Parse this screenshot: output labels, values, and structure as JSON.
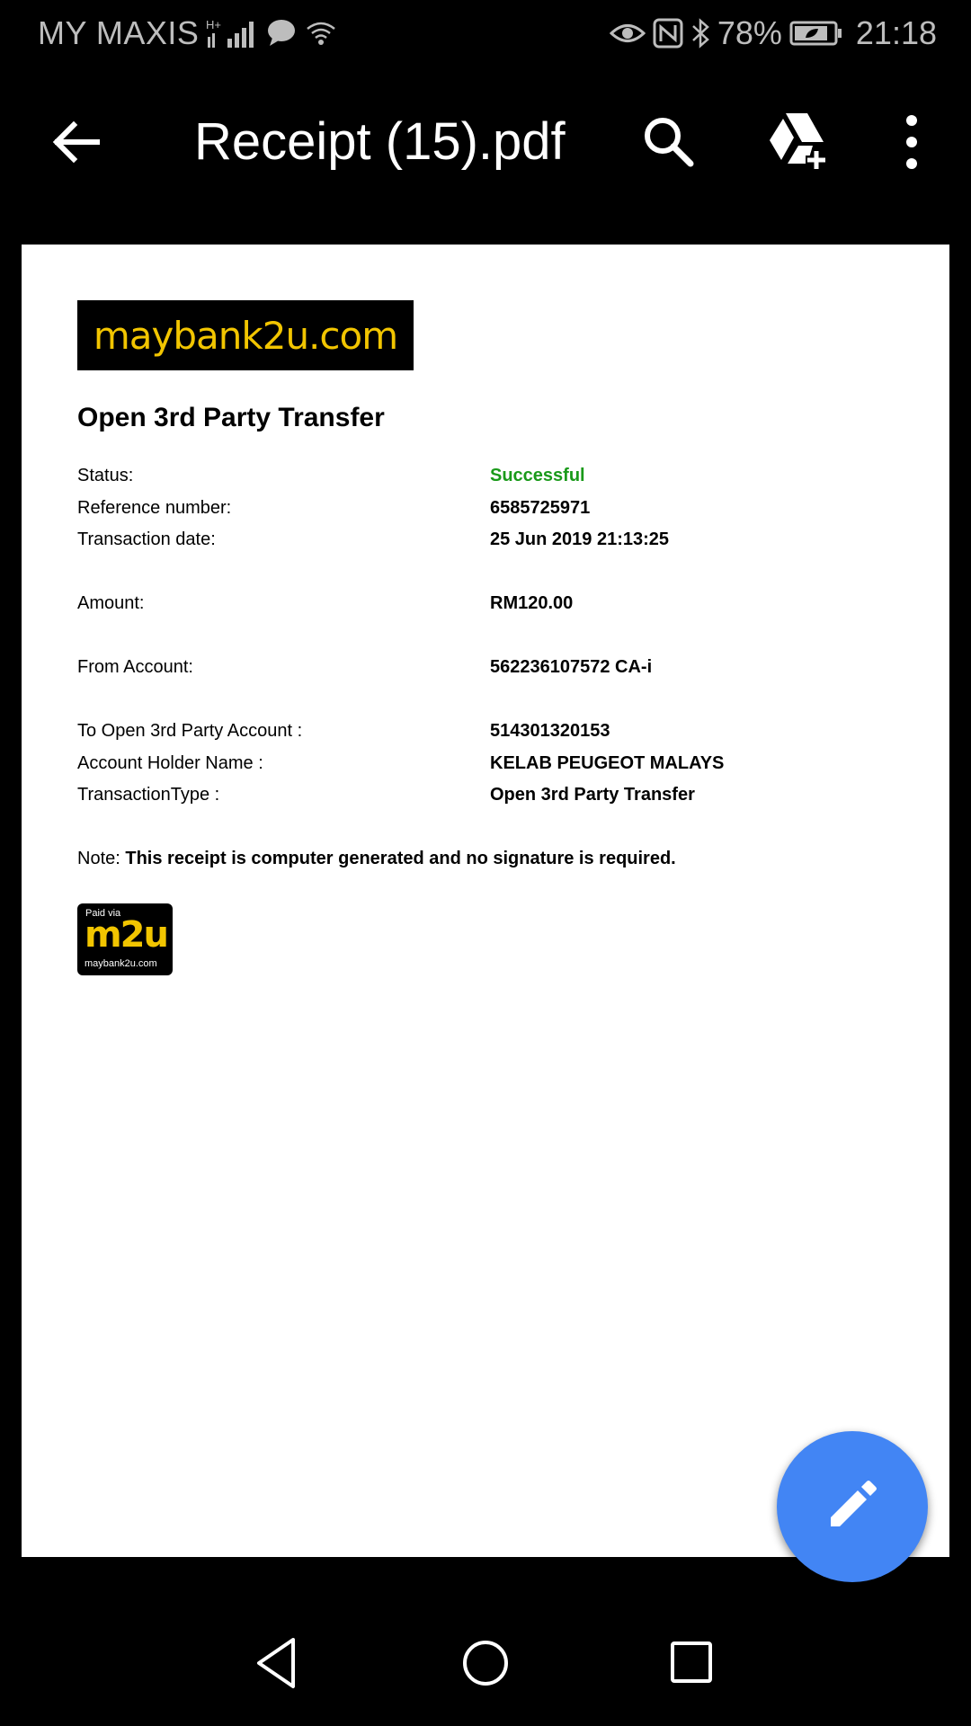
{
  "status_bar": {
    "carrier": "MY MAXIS",
    "network_type": "H+",
    "battery": "78%",
    "time": "21:18"
  },
  "app_bar": {
    "title": "Receipt (15).pdf",
    "icons": [
      "back-arrow-icon",
      "search-icon",
      "drive-add-icon",
      "more-vert-icon"
    ]
  },
  "document": {
    "logo_text": "maybank2u.com",
    "title": "Open 3rd Party Transfer",
    "rows": [
      {
        "label": "Status:",
        "value": "Successful"
      },
      {
        "label": "Reference number:",
        "value": "6585725971"
      },
      {
        "label": "Transaction date:",
        "value": "25 Jun 2019 21:13:25"
      },
      {
        "label": "Amount:",
        "value": "RM120.00"
      },
      {
        "label": "From Account:",
        "value": "562236107572 CA-i"
      },
      {
        "label": "To Open 3rd Party Account :",
        "value": "514301320153"
      },
      {
        "label": "Account Holder Name :",
        "value": "KELAB PEUGEOT MALAYS"
      },
      {
        "label": "TransactionType :",
        "value": "Open 3rd Party Transfer"
      }
    ],
    "note_label": "Note:",
    "note_text": "This receipt is computer generated and no signature is required.",
    "badge": {
      "paid_via": "Paid via",
      "brand": "m2u",
      "site": "maybank2u.com"
    }
  },
  "colors": {
    "success": "#1a9a1a",
    "fab": "#4285f4",
    "brand_yellow": "#f2c500"
  },
  "fab": {
    "icon": "edit-pencil-icon"
  },
  "nav_bar": {
    "icons": [
      "nav-back-icon",
      "nav-home-icon",
      "nav-recents-icon"
    ]
  }
}
